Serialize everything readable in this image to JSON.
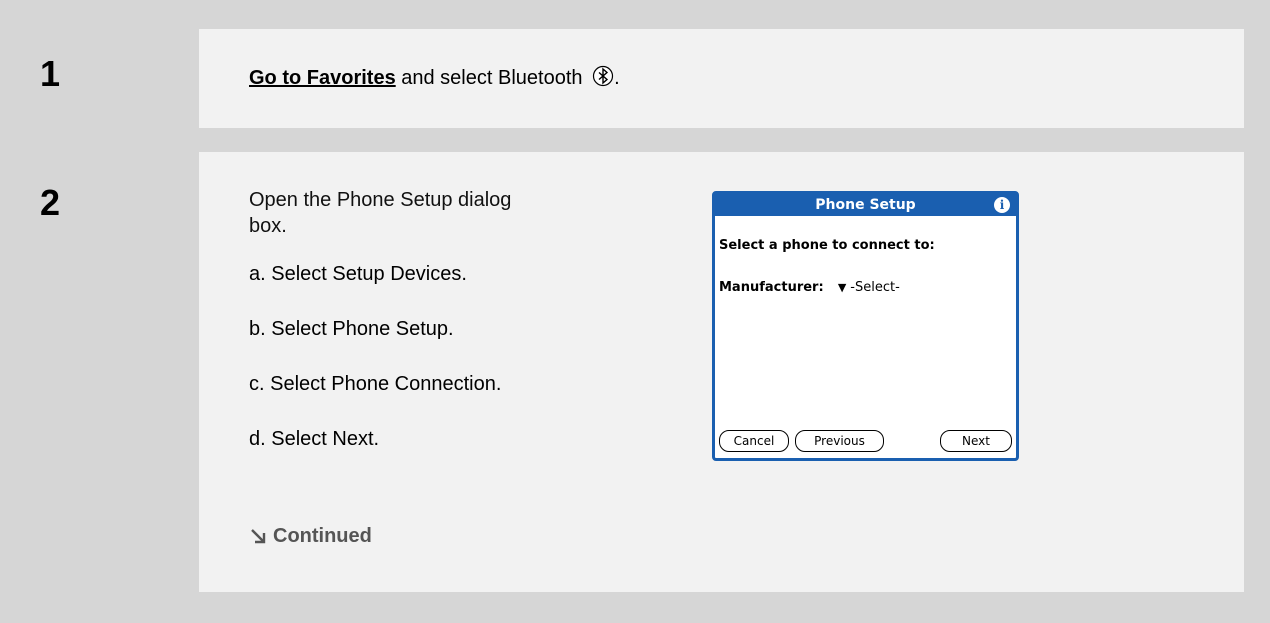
{
  "steps": [
    {
      "number": "1",
      "link_text": "Go to Favorites",
      "text_after": " and select Bluetooth",
      "text_end": "."
    },
    {
      "number": "2",
      "intro": "Open the Phone Setup dialog box.",
      "substeps": [
        "a.  Select Setup Devices.",
        "b.  Select Phone Setup.",
        "c.  Select Phone Connection.",
        "d.  Select Next."
      ],
      "continued": "Continued"
    }
  ],
  "dialog": {
    "title": "Phone Setup",
    "info_icon": "i",
    "prompt": "Select a phone to connect to:",
    "manufacturer_label": "Manufacturer:",
    "manufacturer_value": "-Select-",
    "buttons": {
      "cancel": "Cancel",
      "previous": "Previous",
      "next": "Next"
    }
  },
  "colors": {
    "dialog_accent": "#1a5fb0",
    "background": "#d6d6d6",
    "panel": "#f2f2f2"
  },
  "icons": {
    "bluetooth": "bluetooth-icon",
    "continued": "arrow-down-right-icon"
  }
}
